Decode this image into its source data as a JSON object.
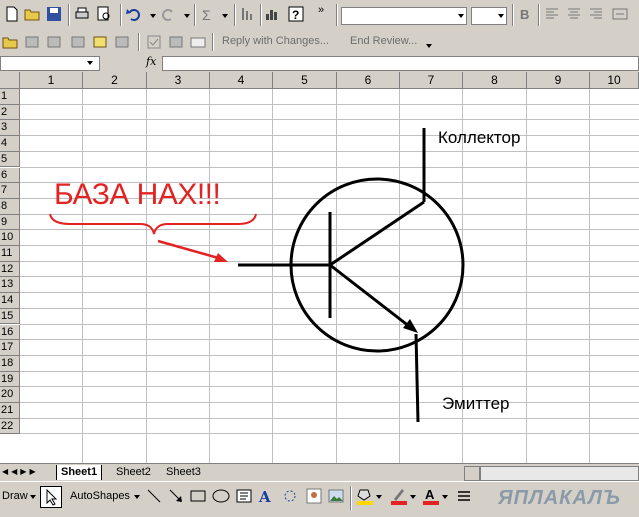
{
  "toolbar": {
    "font_name": "",
    "font_size": "",
    "reply_label": "Reply with Changes...",
    "end_review_label": "End Review..."
  },
  "formula_bar": {
    "name_box": "",
    "fx_label": "fx",
    "content": ""
  },
  "grid": {
    "columns": [
      "1",
      "2",
      "3",
      "4",
      "5",
      "6",
      "7",
      "8",
      "9",
      "10"
    ],
    "rows": [
      "1",
      "2",
      "3",
      "4",
      "5",
      "6",
      "7",
      "8",
      "9",
      "10",
      "11",
      "12",
      "13",
      "14",
      "15",
      "16",
      "17",
      "18",
      "19",
      "20",
      "21",
      "22"
    ]
  },
  "drawing": {
    "base_label": "БАЗА НАХ!!!",
    "collector_label": "Коллектор",
    "emitter_label": "Эмиттер",
    "annotation_color": "#e32222",
    "line_color": "#000000"
  },
  "sheet_tabs": [
    "Sheet1",
    "Sheet2",
    "Sheet3"
  ],
  "active_sheet": "Sheet1",
  "draw_toolbar": {
    "draw_label": "Draw",
    "autoshapes_label": "AutoShapes"
  },
  "watermark": "ЯПЛАКАЛЪ"
}
